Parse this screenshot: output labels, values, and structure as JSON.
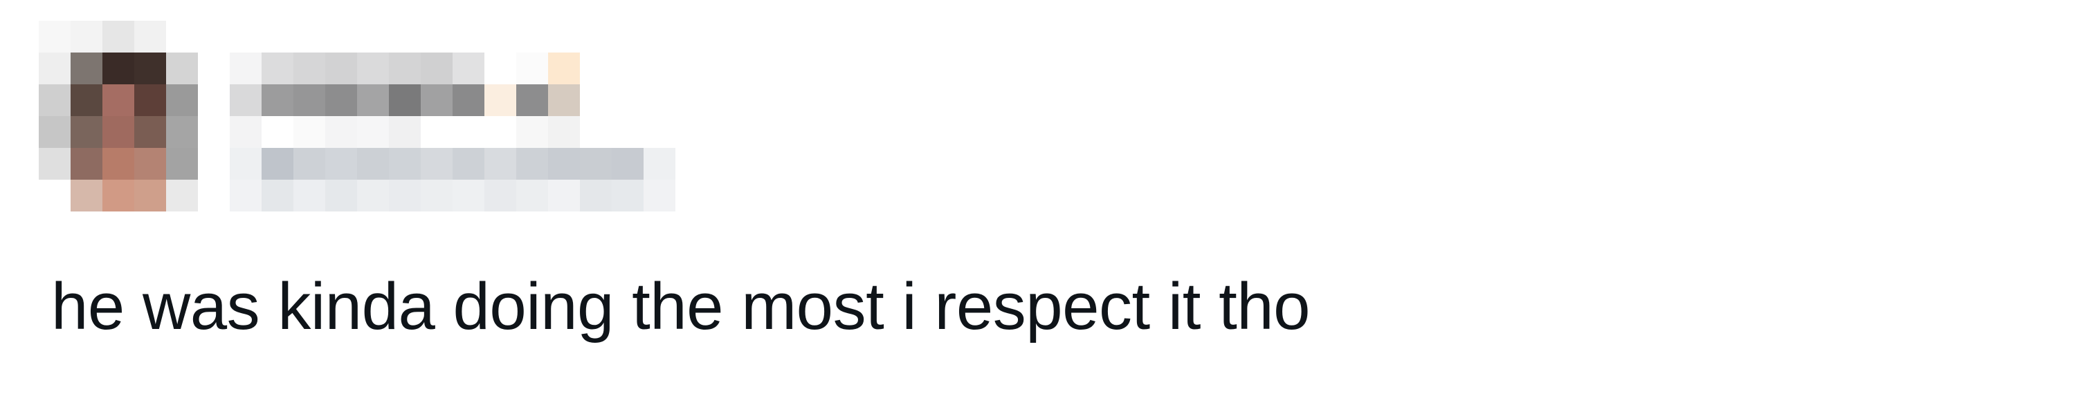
{
  "tweet": {
    "author": {
      "display_name_redacted": true,
      "handle_redacted": true,
      "avatar_redacted": true
    },
    "text": "he was kinda doing the most i respect it tho"
  },
  "colors": {
    "background": "#ffffff",
    "text": "#0f1419"
  }
}
